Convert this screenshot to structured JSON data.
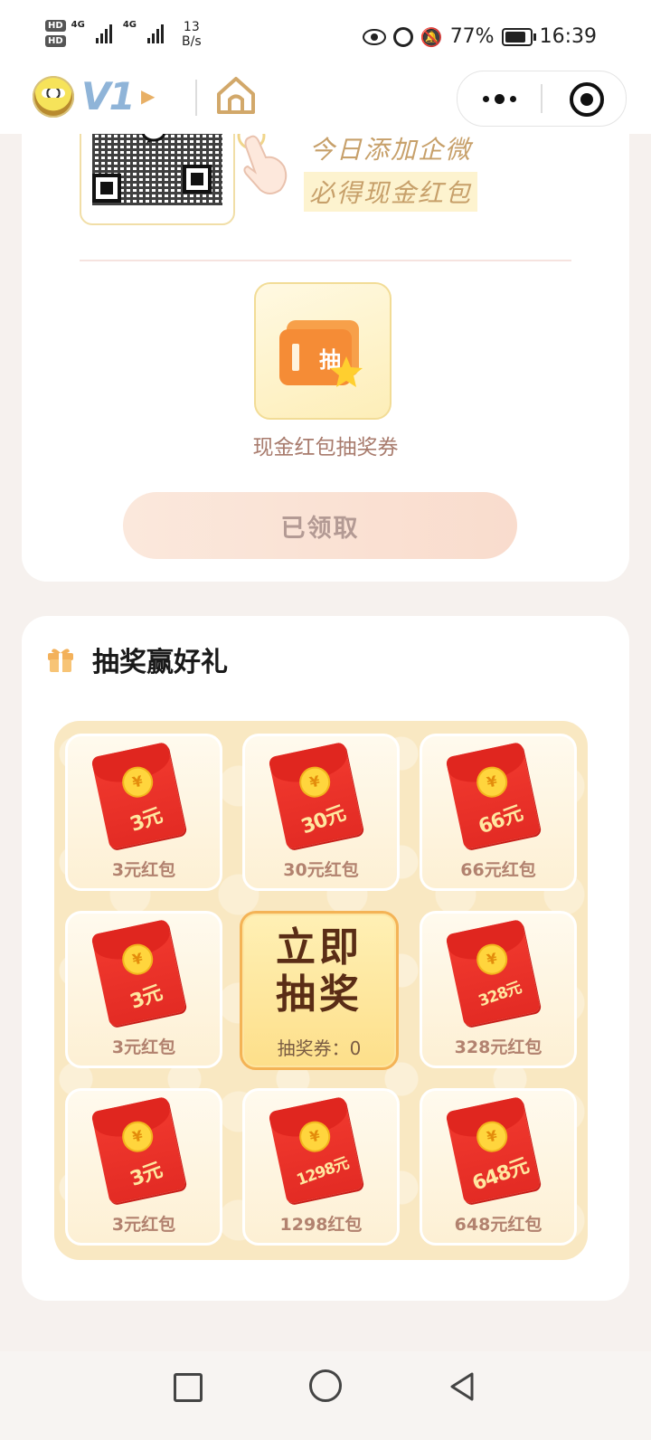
{
  "status_bar": {
    "hd1": "HD",
    "hd2": "HD",
    "sim1_net": "4G",
    "sim2_net": "4G",
    "net_speed_value": "13",
    "net_speed_unit": "B/s",
    "battery": "77%",
    "time": "16:39"
  },
  "nav_bar": {
    "vip_level": "V1"
  },
  "promo": {
    "line1": "今日添加企微",
    "line2": "必得现金红包"
  },
  "reward": {
    "ticket_label": "现金红包抽奖券",
    "ticket_glyph": "抽",
    "claimed_button": "已领取"
  },
  "lottery": {
    "title": "抽奖赢好礼",
    "draw_button": {
      "line1": "立即",
      "line2": "抽奖",
      "ticket_count": "抽奖券：0"
    },
    "prizes": [
      {
        "amount": "3元",
        "label": "3元红包"
      },
      {
        "amount": "30元",
        "label": "30元红包"
      },
      {
        "amount": "66元",
        "label": "66元红包"
      },
      {
        "amount": "3元",
        "label": "3元红包"
      },
      {
        "amount": "328元",
        "label": "328元红包"
      },
      {
        "amount": "3元",
        "label": "3元红包"
      },
      {
        "amount": "1298元",
        "label": "1298红包"
      },
      {
        "amount": "648元",
        "label": "648元红包"
      }
    ]
  },
  "colors": {
    "accent_gold": "#c7a06a",
    "envelope_red": "#e32b24",
    "board_bg": "#f9e8c2"
  }
}
